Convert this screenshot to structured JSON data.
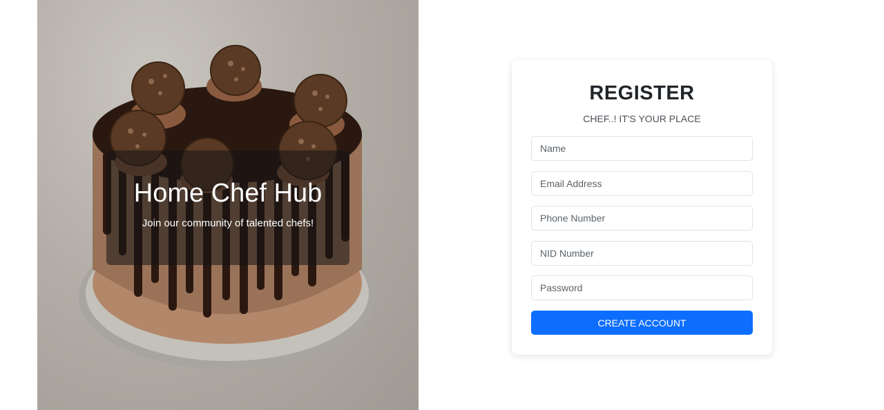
{
  "hero": {
    "title": "Home Chef Hub",
    "subtitle": "Join our community of talented chefs!",
    "image_subject": "chocolate drip cake topped with hazelnut chocolate truffles"
  },
  "register": {
    "title": "REGISTER",
    "subtitle": "CHEF..! IT'S YOUR PLACE",
    "fields": [
      {
        "name": "name",
        "placeholder": "Name",
        "value": ""
      },
      {
        "name": "email",
        "placeholder": "Email Address",
        "value": ""
      },
      {
        "name": "phone",
        "placeholder": "Phone Number",
        "value": ""
      },
      {
        "name": "nid",
        "placeholder": "NID Number",
        "value": ""
      },
      {
        "name": "password",
        "placeholder": "Password",
        "value": ""
      }
    ],
    "submit_label": "CREATE ACCOUNT"
  },
  "colors": {
    "primary": "#0d6efd",
    "text": "#212529",
    "overlay": "rgba(20,20,20,0.55)"
  }
}
